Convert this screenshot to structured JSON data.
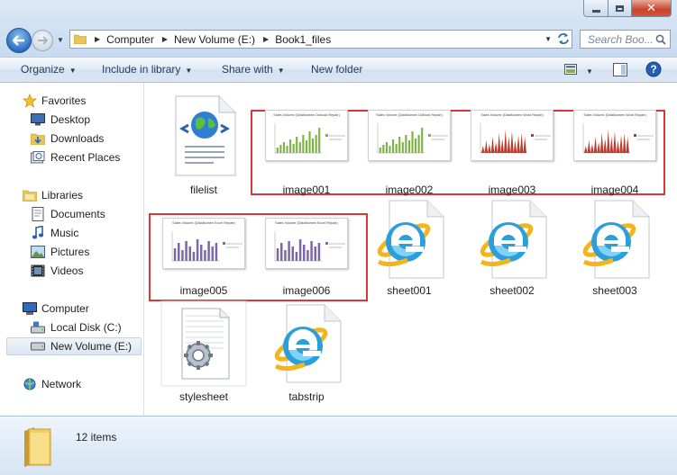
{
  "window": {
    "min_glyph": "minimize",
    "max_glyph": "maximize",
    "close_glyph": "✕"
  },
  "address": {
    "crumbs": [
      "Computer",
      "New Volume (E:)",
      "Book1_files"
    ]
  },
  "search": {
    "placeholder": "Search Boo..."
  },
  "toolbar": {
    "organize": "Organize",
    "include": "Include in library",
    "share": "Share with",
    "new_folder": "New folder"
  },
  "nav": {
    "favorites": "Favorites",
    "desktop": "Desktop",
    "downloads": "Downloads",
    "recent": "Recent Places",
    "libraries": "Libraries",
    "documents": "Documents",
    "music": "Music",
    "pictures": "Pictures",
    "videos": "Videos",
    "computer": "Computer",
    "local_disk": "Local Disk (C:)",
    "new_volume": "New Volume (E:)",
    "network": "Network"
  },
  "files": [
    {
      "name": "filelist",
      "type": "html-doc",
      "icon": "globe-document-icon"
    },
    {
      "name": "image001",
      "type": "chart-image",
      "chart": "green",
      "title": "Sales Volume (DataNumen Outlook Repair)"
    },
    {
      "name": "image002",
      "type": "chart-image",
      "chart": "green",
      "title": "Sales Volume (DataNumen Outlook Repair)"
    },
    {
      "name": "image003",
      "type": "chart-image",
      "chart": "red",
      "title": "Sales Volume (DataNumen Word Repair)"
    },
    {
      "name": "image004",
      "type": "chart-image",
      "chart": "red",
      "title": "Sales Volume (DataNumen Word Repair)"
    },
    {
      "name": "image005",
      "type": "chart-image",
      "chart": "purple",
      "title": "Sales Volume (DataNumen Excel Repair)"
    },
    {
      "name": "image006",
      "type": "chart-image",
      "chart": "purple",
      "title": "Sales Volume (DataNumen Excel Repair)"
    },
    {
      "name": "sheet001",
      "type": "ie-doc",
      "icon": "internet-explorer-icon"
    },
    {
      "name": "sheet002",
      "type": "ie-doc",
      "icon": "internet-explorer-icon"
    },
    {
      "name": "sheet003",
      "type": "ie-doc",
      "icon": "internet-explorer-icon"
    },
    {
      "name": "stylesheet",
      "type": "css-doc",
      "icon": "gear-document-icon"
    },
    {
      "name": "tabstrip",
      "type": "ie-doc",
      "icon": "internet-explorer-icon"
    }
  ],
  "status": {
    "count": "12 items"
  },
  "colors": {
    "highlight": "#d9373a",
    "green": "#7cb342",
    "red": "#c0392b",
    "purple": "#7b68a6"
  }
}
